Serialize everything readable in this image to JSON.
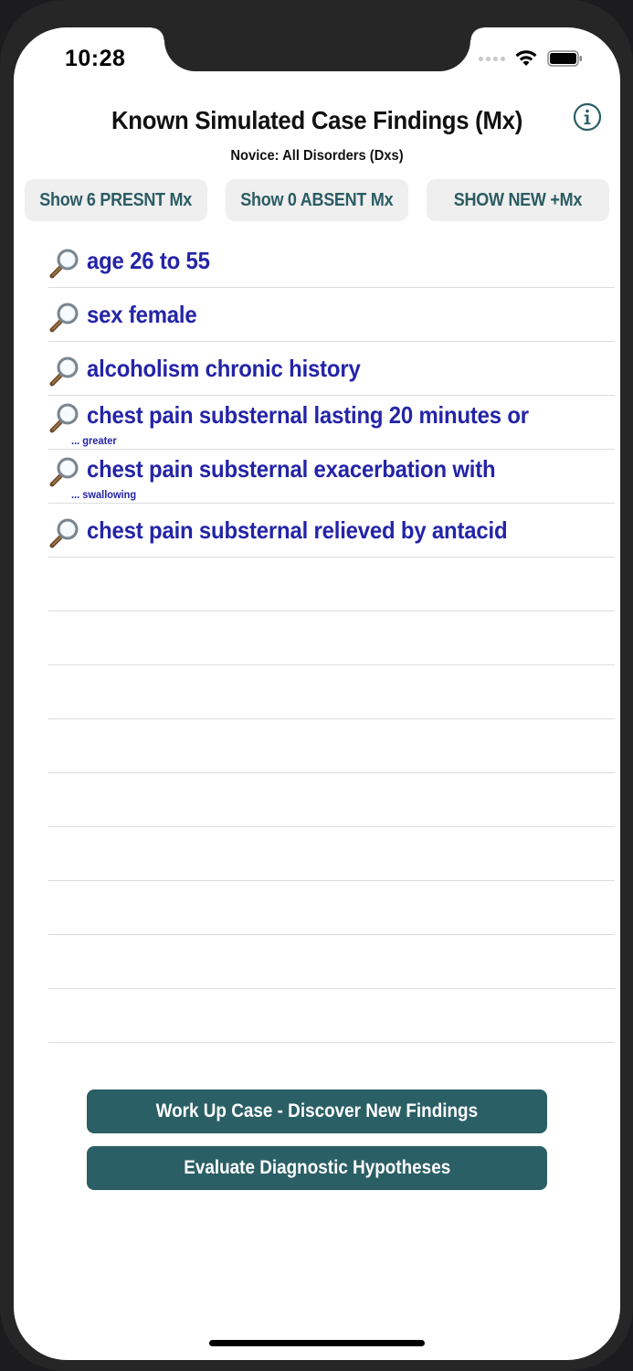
{
  "status": {
    "time": "10:28"
  },
  "header": {
    "title": "Known Simulated Case Findings (Mx)",
    "subtitle": "Novice: All Disorders (Dxs)"
  },
  "filters": {
    "present_label": "Show 6 PRESNT Mx",
    "absent_label": "Show 0 ABSENT Mx",
    "new_label": "SHOW NEW +Mx"
  },
  "findings": [
    {
      "label": "age 26 to 55",
      "sub": ""
    },
    {
      "label": "sex female",
      "sub": ""
    },
    {
      "label": "alcoholism chronic history",
      "sub": ""
    },
    {
      "label": "chest pain substernal lasting 20 minutes or",
      "sub": "... greater"
    },
    {
      "label": "chest pain substernal exacerbation with",
      "sub": "... swallowing"
    },
    {
      "label": "chest pain substernal relieved by antacid",
      "sub": ""
    }
  ],
  "actions": {
    "workup_label": "Work Up Case - Discover New Findings",
    "evaluate_label": "Evaluate Diagnostic Hypotheses"
  },
  "colors": {
    "accent": "#2b5f66",
    "finding_text": "#2424a8"
  }
}
